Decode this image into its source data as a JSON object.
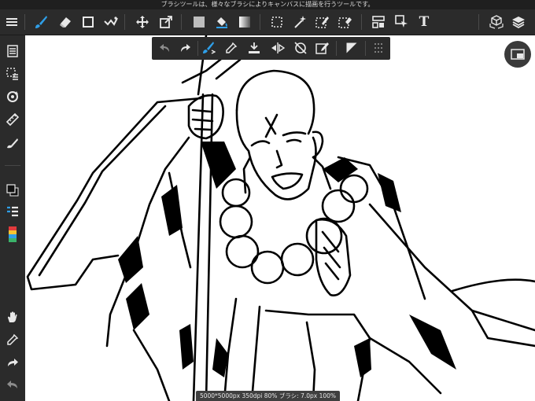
{
  "tooltip": "ブラシツールは、様々なブラシによりキャンバスに描画を行うツールです。",
  "toolbar": {
    "left": [
      {
        "name": "menu-icon"
      },
      {
        "name": "brush-icon",
        "active": true
      },
      {
        "name": "eraser-icon"
      },
      {
        "name": "rectangle-icon"
      },
      {
        "name": "filter-icon"
      },
      {
        "name": "move-icon"
      },
      {
        "name": "transform-icon"
      },
      {
        "name": "fill-color-icon"
      },
      {
        "name": "bucket-icon"
      },
      {
        "name": "gradient-icon"
      },
      {
        "name": "select-rect-icon"
      },
      {
        "name": "magic-wand-icon"
      },
      {
        "name": "select-pen-icon"
      },
      {
        "name": "select-eraser-icon"
      },
      {
        "name": "layout-icon"
      },
      {
        "name": "select-layer-icon"
      },
      {
        "name": "text-icon",
        "glyph": "T"
      },
      {
        "name": "3d-icon"
      },
      {
        "name": "layers-icon"
      }
    ]
  },
  "subbar": {
    "items": [
      "undo-icon",
      "redo-icon",
      "brush-settings-icon",
      "eyedropper-icon",
      "import-icon",
      "flip-icon",
      "rotate-lock-icon",
      "edit-icon",
      "invert-icon",
      "grid-icon"
    ]
  },
  "sidebar": {
    "items": [
      "layer-panel-icon",
      "selection-icon",
      "rotate-view-icon",
      "ruler-icon",
      "fill-icon",
      "color-swap-icon",
      "layer-list-icon",
      "palette-icon",
      "hand-icon",
      "side-eyedropper-icon",
      "side-redo-icon",
      "side-undo-icon"
    ]
  },
  "colors": {
    "accent": "#2f9fe8",
    "toolbar": "#2b2b2b",
    "icon": "#e8e8e8"
  },
  "status": "5000*5000px 350dpi 80% ブラシ: 7.0px 100%"
}
